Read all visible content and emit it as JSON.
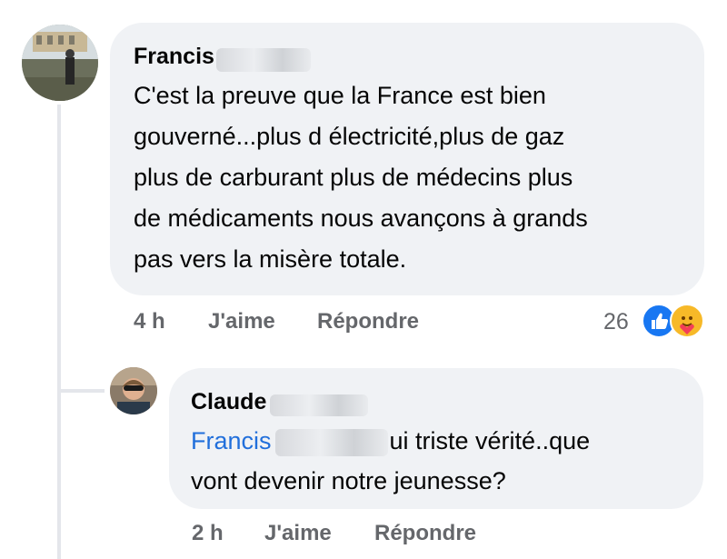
{
  "comment": {
    "author": "Francis",
    "lines": [
      "C'est la preuve que la France est bien",
      "gouverné...plus d électricité,plus de gaz",
      "plus de carburant plus de médecins plus",
      "de médicaments nous avançons à grands",
      "pas vers la misère totale."
    ],
    "time": "4 h",
    "like_label": "J'aime",
    "reply_label": "Répondre",
    "reaction_count": "26",
    "reactions": [
      "like-icon",
      "care-icon"
    ],
    "colors": {
      "like": "#1877f2",
      "care": "#f7b928"
    }
  },
  "reply": {
    "author": "Claude",
    "mention": "Francis",
    "line1_rest": "ui triste vérité..que",
    "line2": "vont devenir notre jeunesse?",
    "time": "2 h",
    "like_label": "J'aime",
    "reply_label": "Répondre"
  }
}
